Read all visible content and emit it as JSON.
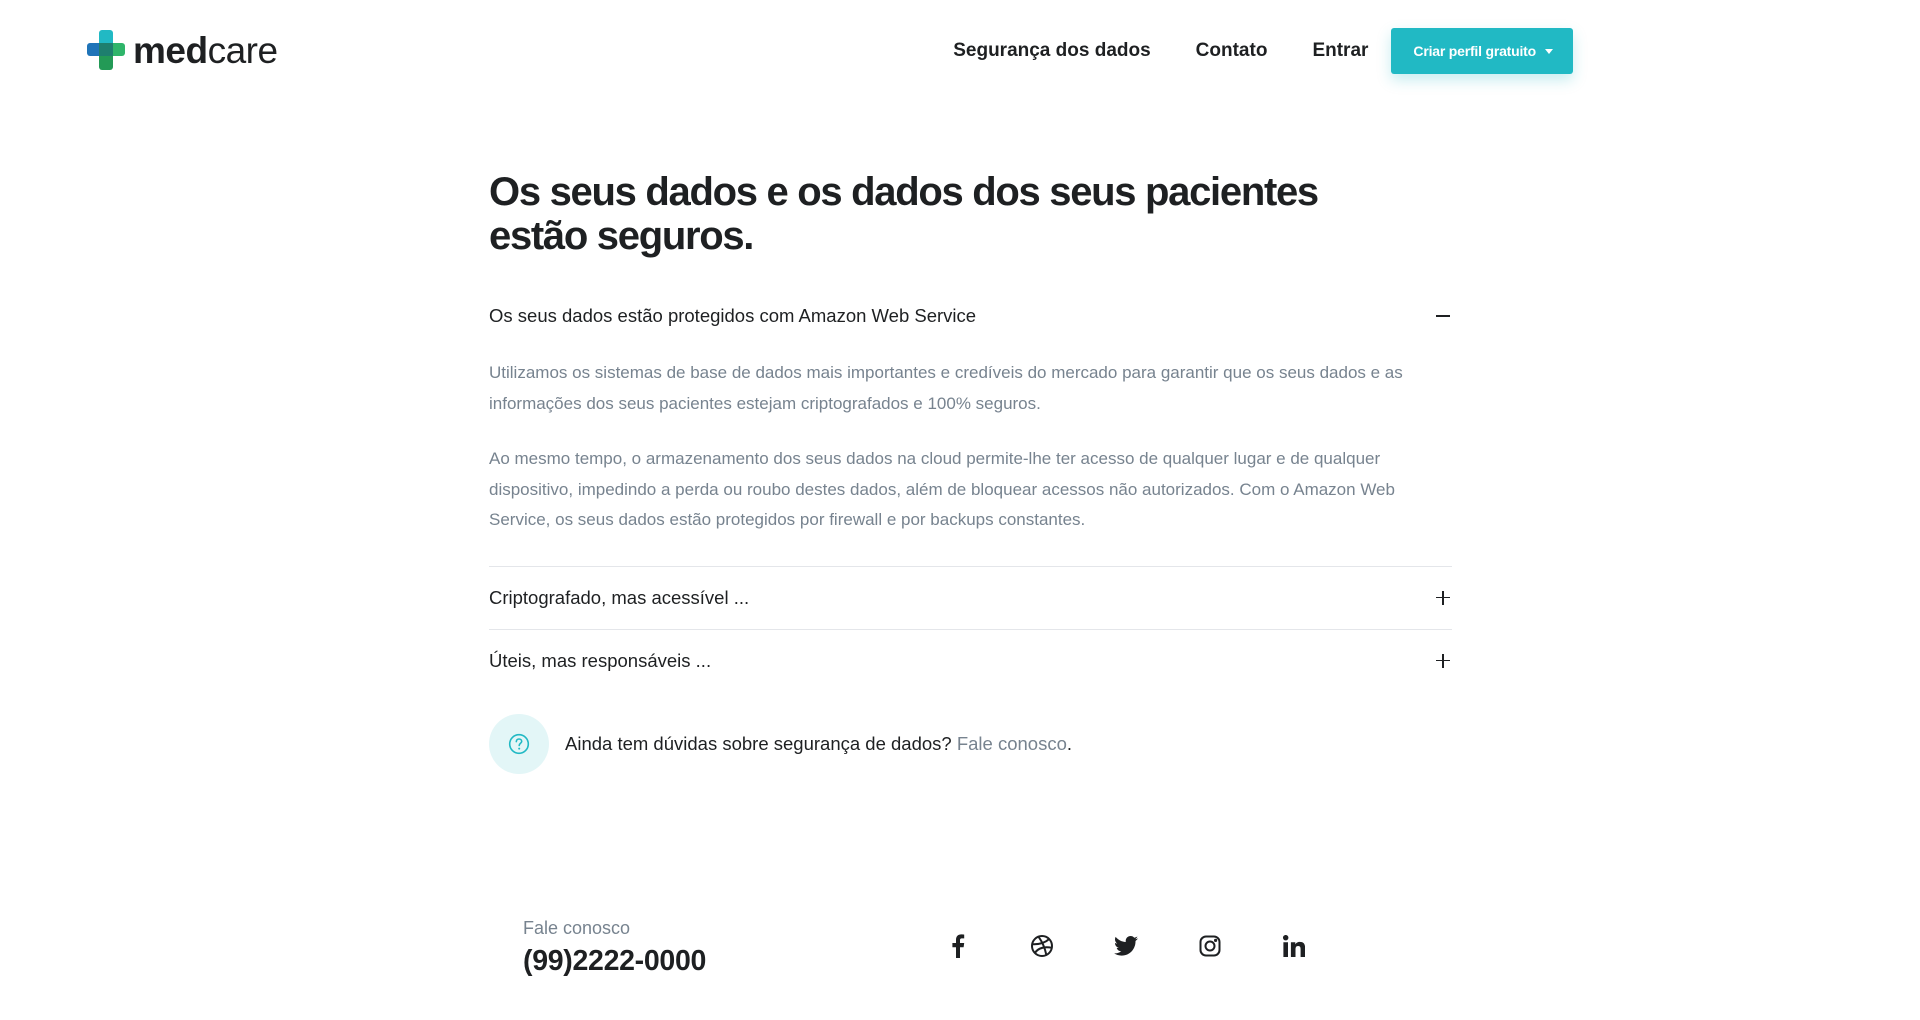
{
  "header": {
    "logo_bold": "med",
    "logo_light": "care",
    "nav": [
      {
        "label": "Segurança dos dados"
      },
      {
        "label": "Contato"
      },
      {
        "label": "Entrar"
      }
    ],
    "cta_label": "Criar perfil gratuito"
  },
  "main": {
    "title": "Os seus dados e os dados dos seus pacientes estão seguros.",
    "accordion": [
      {
        "title": "Os seus dados estão protegidos com Amazon Web Service",
        "expanded": true,
        "paragraphs": [
          "Utilizamos os sistemas de base de dados mais importantes e credíveis do mercado para garantir que os seus dados e as informações dos seus pacientes estejam criptografados e 100% seguros.",
          "Ao mesmo tempo, o armazenamento dos seus dados na cloud permite-lhe ter acesso de qualquer lugar e de qualquer dispositivo, impedindo a perda ou roubo destes dados, além de bloquear acessos não autorizados. Com o Amazon Web Service, os seus dados estão protegidos por firewall e por backups constantes."
        ]
      },
      {
        "title": "Criptografado, mas acessível ...",
        "expanded": false
      },
      {
        "title": "Úteis, mas responsáveis ...",
        "expanded": false
      }
    ],
    "help": {
      "text": "Ainda tem dúvidas sobre segurança de dados?",
      "link": "Fale conosco",
      "suffix": "."
    }
  },
  "footer": {
    "contact_label": "Fale conosco",
    "phone": "(99)2222-0000",
    "social_icons": [
      "facebook-icon",
      "dribbble-icon",
      "twitter-icon",
      "instagram-icon",
      "linkedin-icon"
    ]
  },
  "colors": {
    "accent": "#21b9c4",
    "text_dark": "#1e2022",
    "text_muted": "#77838f",
    "help_bg": "#e3f6f7"
  }
}
